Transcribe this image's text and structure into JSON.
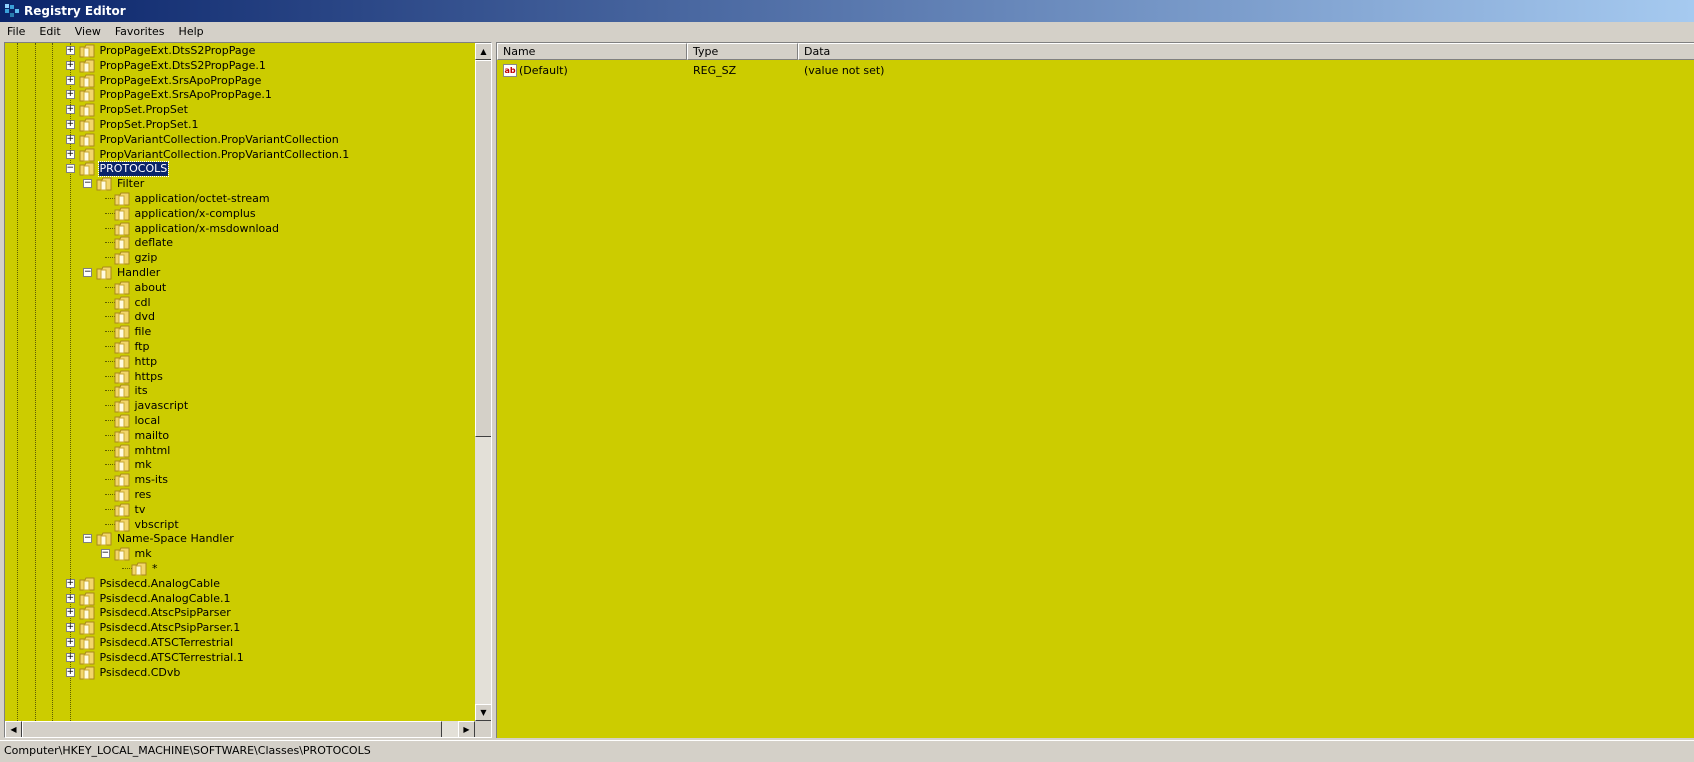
{
  "window": {
    "title": "Registry Editor"
  },
  "menu": [
    "File",
    "Edit",
    "View",
    "Favorites",
    "Help"
  ],
  "tree": [
    {
      "label": "PropPageExt.DtsS2PropPage",
      "depth": 4,
      "expander": "+"
    },
    {
      "label": "PropPageExt.DtsS2PropPage.1",
      "depth": 4,
      "expander": "+"
    },
    {
      "label": "PropPageExt.SrsApoPropPage",
      "depth": 4,
      "expander": "+"
    },
    {
      "label": "PropPageExt.SrsApoPropPage.1",
      "depth": 4,
      "expander": "+"
    },
    {
      "label": "PropSet.PropSet",
      "depth": 4,
      "expander": "+"
    },
    {
      "label": "PropSet.PropSet.1",
      "depth": 4,
      "expander": "+"
    },
    {
      "label": "PropVariantCollection.PropVariantCollection",
      "depth": 4,
      "expander": "+"
    },
    {
      "label": "PropVariantCollection.PropVariantCollection.1",
      "depth": 4,
      "expander": "+"
    },
    {
      "label": "PROTOCOLS",
      "depth": 4,
      "expander": "-",
      "selected": true
    },
    {
      "label": "Filter",
      "depth": 5,
      "expander": "-"
    },
    {
      "label": "application/octet-stream",
      "depth": 6,
      "expander": ""
    },
    {
      "label": "application/x-complus",
      "depth": 6,
      "expander": ""
    },
    {
      "label": "application/x-msdownload",
      "depth": 6,
      "expander": ""
    },
    {
      "label": "deflate",
      "depth": 6,
      "expander": ""
    },
    {
      "label": "gzip",
      "depth": 6,
      "expander": ""
    },
    {
      "label": "Handler",
      "depth": 5,
      "expander": "-"
    },
    {
      "label": "about",
      "depth": 6,
      "expander": ""
    },
    {
      "label": "cdl",
      "depth": 6,
      "expander": ""
    },
    {
      "label": "dvd",
      "depth": 6,
      "expander": ""
    },
    {
      "label": "file",
      "depth": 6,
      "expander": ""
    },
    {
      "label": "ftp",
      "depth": 6,
      "expander": ""
    },
    {
      "label": "http",
      "depth": 6,
      "expander": ""
    },
    {
      "label": "https",
      "depth": 6,
      "expander": ""
    },
    {
      "label": "its",
      "depth": 6,
      "expander": ""
    },
    {
      "label": "javascript",
      "depth": 6,
      "expander": ""
    },
    {
      "label": "local",
      "depth": 6,
      "expander": ""
    },
    {
      "label": "mailto",
      "depth": 6,
      "expander": ""
    },
    {
      "label": "mhtml",
      "depth": 6,
      "expander": ""
    },
    {
      "label": "mk",
      "depth": 6,
      "expander": ""
    },
    {
      "label": "ms-its",
      "depth": 6,
      "expander": ""
    },
    {
      "label": "res",
      "depth": 6,
      "expander": ""
    },
    {
      "label": "tv",
      "depth": 6,
      "expander": ""
    },
    {
      "label": "vbscript",
      "depth": 6,
      "expander": ""
    },
    {
      "label": "Name-Space Handler",
      "depth": 5,
      "expander": "-"
    },
    {
      "label": "mk",
      "depth": 6,
      "expander": "-"
    },
    {
      "label": "*",
      "depth": 7,
      "expander": ""
    },
    {
      "label": "Psisdecd.AnalogCable",
      "depth": 4,
      "expander": "+"
    },
    {
      "label": "Psisdecd.AnalogCable.1",
      "depth": 4,
      "expander": "+"
    },
    {
      "label": "Psisdecd.AtscPsipParser",
      "depth": 4,
      "expander": "+"
    },
    {
      "label": "Psisdecd.AtscPsipParser.1",
      "depth": 4,
      "expander": "+"
    },
    {
      "label": "Psisdecd.ATSCTerrestrial",
      "depth": 4,
      "expander": "+"
    },
    {
      "label": "Psisdecd.ATSCTerrestrial.1",
      "depth": 4,
      "expander": "+"
    },
    {
      "label": "Psisdecd.CDvb",
      "depth": 4,
      "expander": "+"
    }
  ],
  "list": {
    "columns": [
      "Name",
      "Type",
      "Data"
    ],
    "rows": [
      {
        "name": "(Default)",
        "type": "REG_SZ",
        "data": "(value not set)",
        "icon": "string-value-icon"
      }
    ]
  },
  "status": {
    "path": "Computer\\HKEY_LOCAL_MACHINE\\SOFTWARE\\Classes\\PROTOCOLS"
  },
  "colors": {
    "pane_background": "#cccc00",
    "selection": "#0a246a",
    "chrome": "#d4d0c8"
  }
}
